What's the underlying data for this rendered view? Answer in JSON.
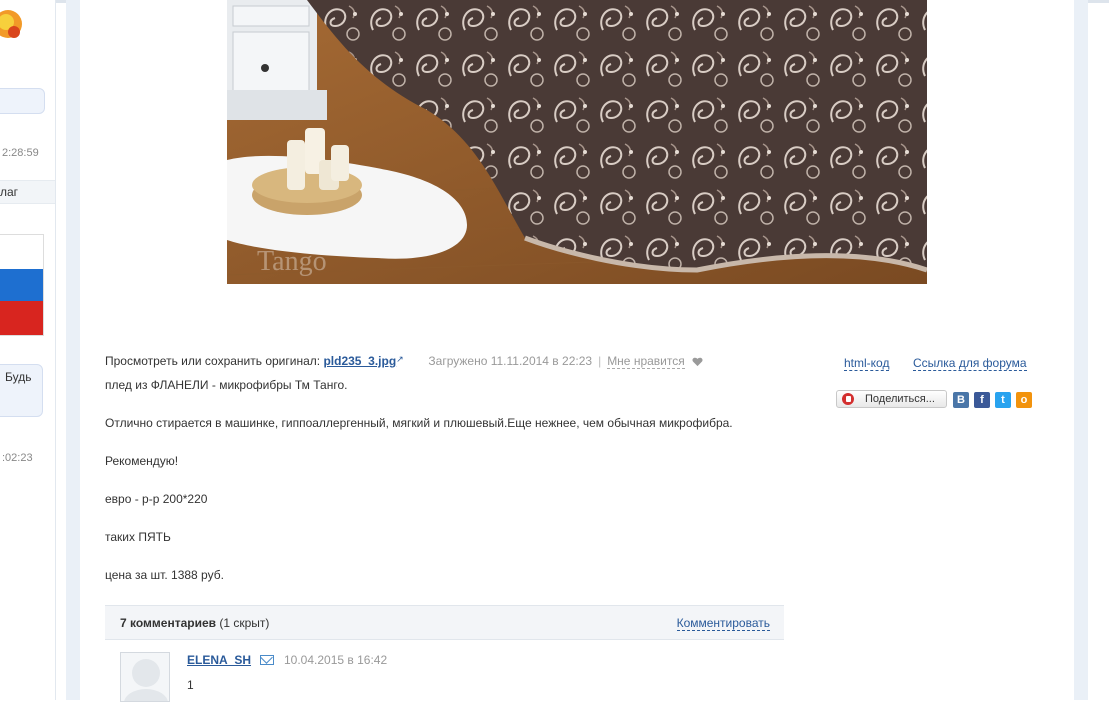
{
  "left_panel": {
    "time1": "2:28:59",
    "row_label": "лаг",
    "box_text": "Будь",
    "time2": ":02:23"
  },
  "photo": {
    "watermark": "Tango"
  },
  "meta": {
    "view_label": "Просмотреть или сохранить оригинал:",
    "file_link": "pld235_3.jpg",
    "uploaded": "Загружено 11.11.2014 в 22:23",
    "separator": "|",
    "like": "Мне нравится"
  },
  "actions": {
    "html_code": "html-код",
    "forum_link": "Ссылка для форума",
    "share": "Поделиться..."
  },
  "social": [
    {
      "name": "vkontakte",
      "letter": "B",
      "color": "#4a76a8"
    },
    {
      "name": "facebook",
      "letter": "f",
      "color": "#3b5998"
    },
    {
      "name": "twitter",
      "letter": "t",
      "color": "#29a3ef"
    },
    {
      "name": "odnoklassniki",
      "letter": "о",
      "color": "#f2930d"
    }
  ],
  "description": [
    "плед из ФЛАНЕЛИ - микрофибры Тм Танго.",
    "Отлично стирается в машинке, гиппоаллергенный, мягкий и плюшевый.Еще нежнее, чем обычная микрофибра.",
    "Рекомендую!",
    "евро - р-р 200*220",
    "таких ПЯТЬ",
    "цена за шт. 1388 руб."
  ],
  "comments": {
    "count_label": "7 комментариев",
    "hidden_label": "(1 скрыт)",
    "action": "Комментировать",
    "items": [
      {
        "author": "ELENA_SH",
        "date": "10.04.2015 в 16:42",
        "text": "1"
      }
    ]
  }
}
